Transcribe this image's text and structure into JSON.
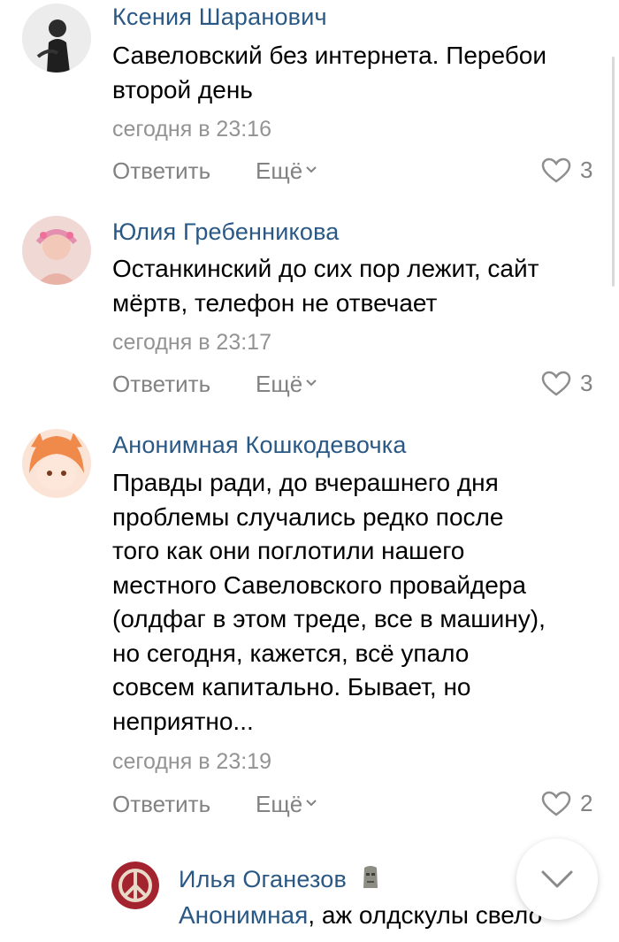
{
  "comments": [
    {
      "author": "Ксения Шаранович",
      "text": "Савеловский без интернета. Перебои\nвторой день",
      "time": "сегодня в 23:16",
      "reply": "Ответить",
      "more": "Ещё",
      "likes": "3"
    },
    {
      "author": "Юлия Гребенникова",
      "text": "Останкинский до сих пор лежит, сайт\nмёртв, телефон не отвечает",
      "time": "сегодня в 23:17",
      "reply": "Ответить",
      "more": "Ещё",
      "likes": "3"
    },
    {
      "author": "Анонимная Кошкодевочка",
      "text": "Правды ради, до вчерашнего дня\nпроблемы случались редко после\nтого как они поглотили нашего\nместного Савеловского провайдера\n(олдфаг в этом треде, все в машину),\nно сегодня, кажется, всё упало\nсовсем капитально. Бывает, но\nнеприятно...",
      "time": "сегодня в 23:19",
      "reply": "Ответить",
      "more": "Ещё",
      "likes": "2"
    }
  ],
  "reply_comment": {
    "author": "Илья Оганезов",
    "mention": "Анонимная",
    "text": ", аж олдскулы свело"
  },
  "colors": {
    "link": "#2a5885",
    "secondary": "#939393",
    "action": "#828282"
  },
  "icons": {
    "like": "heart-outline-icon",
    "more": "chevron-down-icon",
    "scroll": "chevron-down-icon",
    "author_badge": "moai-emoji-icon"
  }
}
